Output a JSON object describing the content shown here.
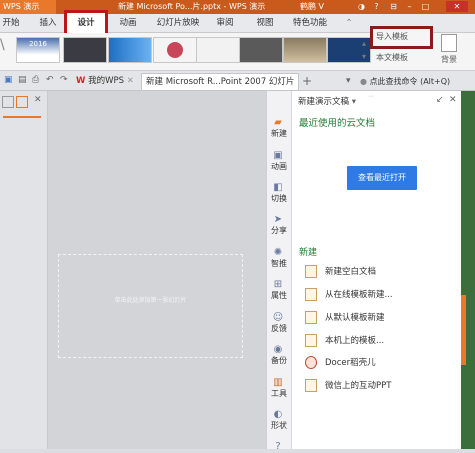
{
  "titlebar": {
    "app_name": "WPS 演示",
    "doc_title": "新建 Microsoft Po...片.pptx - WPS 演示",
    "user": "鹤鹏 V"
  },
  "ribbon_tabs": [
    {
      "label": "开始"
    },
    {
      "label": "插入"
    },
    {
      "label": "设计",
      "selected": true
    },
    {
      "label": "动画"
    },
    {
      "label": "幻灯片放映"
    },
    {
      "label": "审阅"
    },
    {
      "label": "视图"
    },
    {
      "label": "特色功能"
    }
  ],
  "ribbon": {
    "thumb_label": "2016",
    "import_template": "导入模板",
    "this_template": "本文模板",
    "background": "背景"
  },
  "doc_tabs": {
    "my_wps": "我的WPS",
    "doc": "新建 Microsoft R...Point 2007 幻灯片",
    "command_search": "点此查找命令 (Alt+Q)"
  },
  "slide": {
    "placeholder": "单击此处添加第一张幻灯片"
  },
  "side_toolbar": [
    {
      "icon": "new-icon",
      "label": "新建"
    },
    {
      "icon": "animation-icon",
      "label": "动画"
    },
    {
      "icon": "switch-icon",
      "label": "切换"
    },
    {
      "icon": "share-icon",
      "label": "分享"
    },
    {
      "icon": "smart-icon",
      "label": "智推"
    },
    {
      "icon": "property-icon",
      "label": "属性"
    },
    {
      "icon": "feedback-icon",
      "label": "反馈"
    },
    {
      "icon": "backup-icon",
      "label": "备份"
    },
    {
      "icon": "tools-icon",
      "label": "工具"
    },
    {
      "icon": "shape-icon",
      "label": "形状"
    }
  ],
  "task_pane": {
    "title": "新建演示文稿",
    "recent_heading": "最近使用的云文档",
    "open_recent": "查看最近打开",
    "new_heading": "新建",
    "new_items": [
      {
        "label": "新建空白文档"
      },
      {
        "label": "从在线模板新建..."
      },
      {
        "label": "从默认模板新建"
      },
      {
        "label": "本机上的模板..."
      },
      {
        "label": "Docer稻壳儿"
      },
      {
        "label": "微信上的互动PPT"
      }
    ]
  },
  "colors": {
    "accent_green": "#1f7e33",
    "button_blue": "#2e7be5",
    "highlight_red": "#c0141b",
    "title_orange": "#e9782b"
  }
}
